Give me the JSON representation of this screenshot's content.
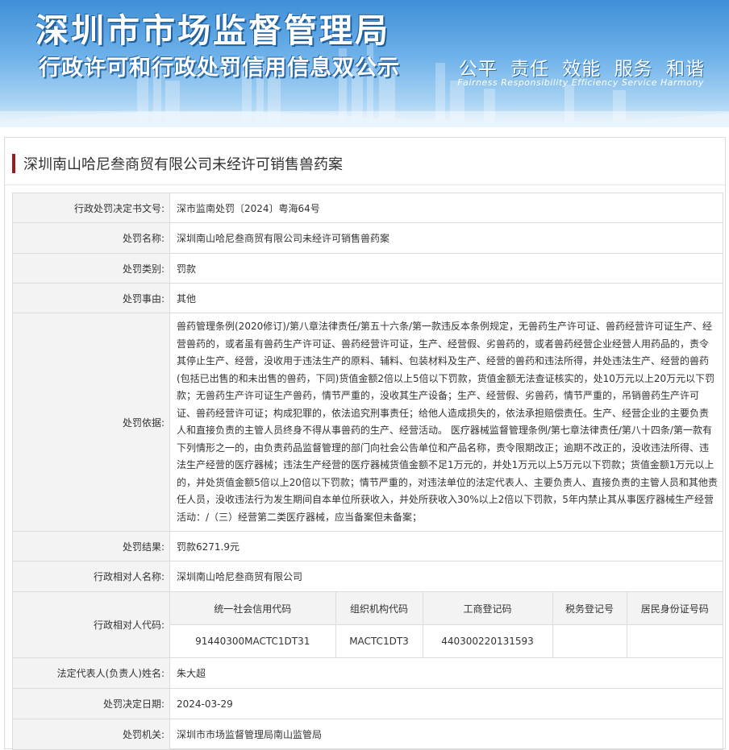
{
  "header": {
    "title": "深圳市市场监督管理局",
    "subtitle": "行政许可和行政处罚信用信息双公示",
    "motto_cn": "公平 责任 效能 服务 和谐",
    "motto_en": "Fairness Responsibility Efficiency Service Harmony"
  },
  "case_title": "深圳南山哈尼叁商贸有限公司未经许可销售兽药案",
  "rows": {
    "decision_no": {
      "label": "行政处罚决定书文号:",
      "value": "深市监南处罚〔2024〕粤海64号"
    },
    "penalty_name": {
      "label": "处罚名称:",
      "value": "深圳南山哈尼叁商贸有限公司未经许可销售兽药案"
    },
    "penalty_type": {
      "label": "处罚类别:",
      "value": "罚款"
    },
    "penalty_reason": {
      "label": "处罚事由:",
      "value": "其他"
    },
    "basis": {
      "label": "处罚依据:",
      "value": "兽药管理条例(2020修订)/第八章法律责任/第五十六条/第一款违反本条例规定，无兽药生产许可证、兽药经营许可证生产、经营兽药的，或者虽有兽药生产许可证、兽药经营许可证，生产、经营假、劣兽药的，或者兽药经营企业经营人用药品的，责令其停止生产、经营，没收用于违法生产的原料、辅料、包装材料及生产、经营的兽药和违法所得，并处违法生产、经营的兽药(包括已出售的和未出售的兽药，下同)货值金额2倍以上5倍以下罚款，货值金额无法查证核实的，处10万元以上20万元以下罚款；无兽药生产许可证生产兽药，情节严重的，没收其生产设备；生产、经营假、劣兽药，情节严重的，吊销兽药生产许可证、兽药经营许可证；构成犯罪的，依法追究刑事责任；给他人造成损失的，依法承担赔偿责任。生产、经营企业的主要负责人和直接负责的主管人员终身不得从事兽药的生产、经营活动。 医疗器械监督管理条例/第七章法律责任/第八十四条/第一款有下列情形之一的，由负责药品监督管理的部门向社会公告单位和产品名称，责令限期改正；逾期不改正的，没收违法所得、违法生产经营的医疗器械；违法生产经营的医疗器械货值金额不足1万元的，并处1万元以上5万元以下罚款；货值金额1万元以上的，并处货值金额5倍以上20倍以下罚款；情节严重的，对违法单位的法定代表人、主要负责人、直接负责的主管人员和其他责任人员，没收违法行为发生期间自本单位所获收入，并处所获收入30%以上2倍以下罚款，5年内禁止其从事医疗器械生产经营活动：/（三）经营第二类医疗器械，应当备案但未备案；"
    },
    "result": {
      "label": "处罚结果:",
      "value": "罚款6271.9元"
    },
    "party_name": {
      "label": "行政相对人名称:",
      "value": "深圳南山哈尼叁商贸有限公司"
    },
    "party_code": {
      "label": "行政相对人代码:"
    },
    "legal_rep": {
      "label": "法定代表人(负责人)姓名:",
      "value": "朱大超"
    },
    "decision_date": {
      "label": "处罚决定日期:",
      "value": "2024-03-29"
    },
    "authority": {
      "label": "处罚机关:",
      "value": "深圳市市场监督管理局南山监管局"
    }
  },
  "codes": {
    "headers": [
      "统一社会信用代码",
      "组织机构代码",
      "工商登记码",
      "税务登记号",
      "居民身份证号码"
    ],
    "values": [
      "91440300MACTC1DT31",
      "MACTC1DT3",
      "440300220131593",
      "",
      ""
    ]
  },
  "colors": {
    "accent": "#9b1b1b",
    "banner_top": "#3f8fd6",
    "label_bg": "#f3f3f3",
    "border": "#dcdcdc"
  }
}
